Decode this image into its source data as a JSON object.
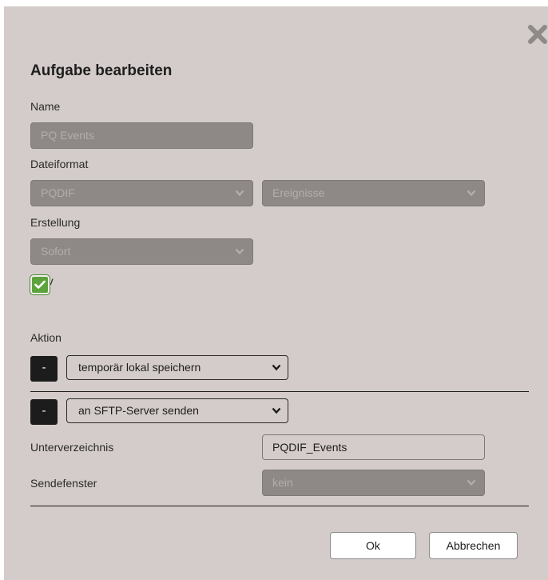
{
  "dialog": {
    "title": "Aufgabe bearbeiten",
    "close_icon": "close-icon"
  },
  "form": {
    "name_label": "Name",
    "name_value": "PQ Events",
    "dateiformat_label": "Dateiformat",
    "format_value": "PQDIF",
    "type_value": "Ereignisse",
    "erstellung_label": "Erstellung",
    "erstellung_value": "Sofort",
    "aktiv_label": "aktiv",
    "aktiv_checked": true,
    "aktion_label": "Aktion"
  },
  "actions": [
    {
      "remove_label": "-",
      "value": "temporär lokal speichern"
    },
    {
      "remove_label": "-",
      "value": "an SFTP-Server senden"
    }
  ],
  "sftp": {
    "unterverzeichnis_label": "Unterverzeichnis",
    "unterverzeichnis_value": "PQDIF_Events",
    "sendefenster_label": "Sendefenster",
    "sendefenster_value": "kein"
  },
  "buttons": {
    "ok_label": "Ok",
    "cancel_label": "Abbrechen"
  },
  "colors": {
    "dialog_bg": "#d4ccca",
    "disabled_field": "#8e8987",
    "checkbox_green": "#5da23b",
    "dark_button": "#1c1c1c"
  }
}
